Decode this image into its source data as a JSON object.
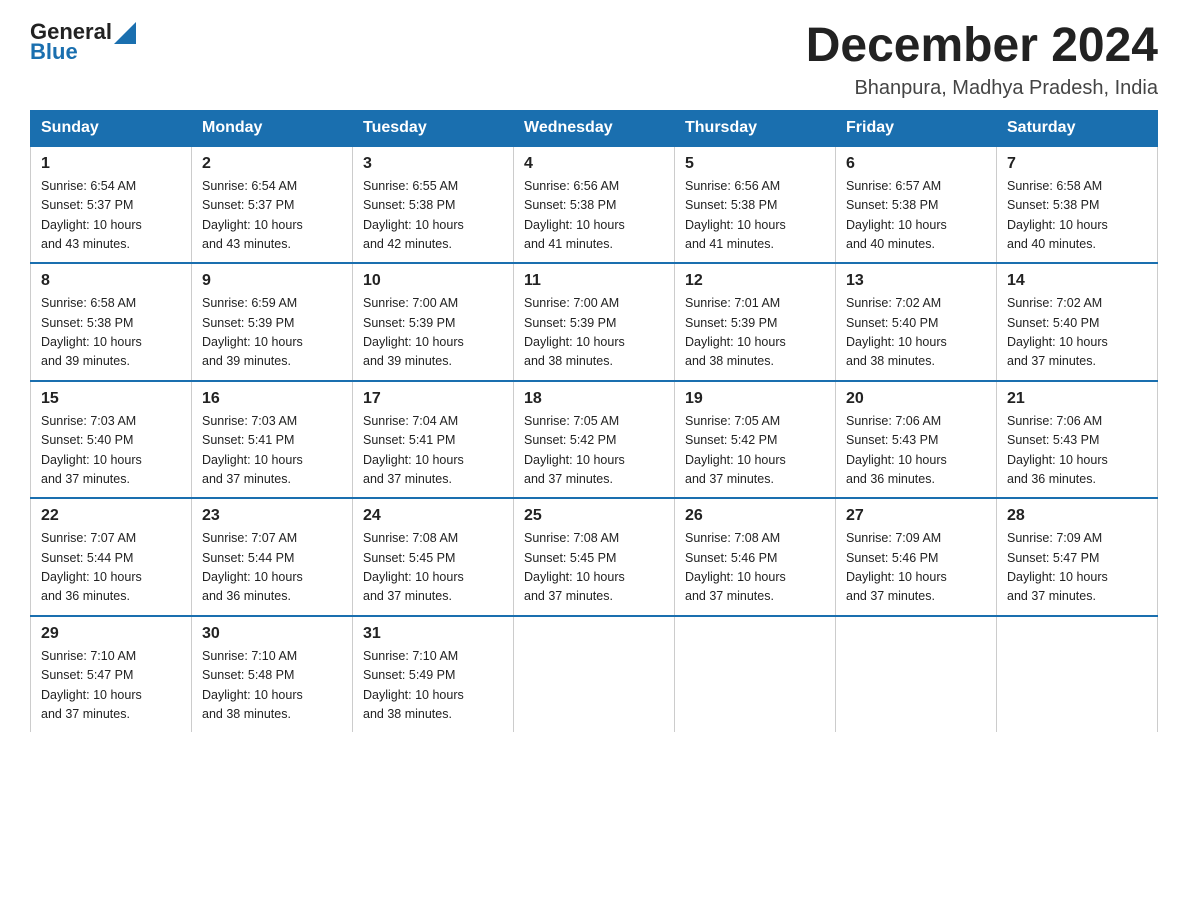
{
  "header": {
    "logo_text_main": "General",
    "logo_text_blue": "Blue",
    "month_year": "December 2024",
    "location": "Bhanpura, Madhya Pradesh, India"
  },
  "days_of_week": [
    "Sunday",
    "Monday",
    "Tuesday",
    "Wednesday",
    "Thursday",
    "Friday",
    "Saturday"
  ],
  "weeks": [
    [
      {
        "day": "1",
        "sunrise": "6:54 AM",
        "sunset": "5:37 PM",
        "daylight": "10 hours and 43 minutes."
      },
      {
        "day": "2",
        "sunrise": "6:54 AM",
        "sunset": "5:37 PM",
        "daylight": "10 hours and 43 minutes."
      },
      {
        "day": "3",
        "sunrise": "6:55 AM",
        "sunset": "5:38 PM",
        "daylight": "10 hours and 42 minutes."
      },
      {
        "day": "4",
        "sunrise": "6:56 AM",
        "sunset": "5:38 PM",
        "daylight": "10 hours and 41 minutes."
      },
      {
        "day": "5",
        "sunrise": "6:56 AM",
        "sunset": "5:38 PM",
        "daylight": "10 hours and 41 minutes."
      },
      {
        "day": "6",
        "sunrise": "6:57 AM",
        "sunset": "5:38 PM",
        "daylight": "10 hours and 40 minutes."
      },
      {
        "day": "7",
        "sunrise": "6:58 AM",
        "sunset": "5:38 PM",
        "daylight": "10 hours and 40 minutes."
      }
    ],
    [
      {
        "day": "8",
        "sunrise": "6:58 AM",
        "sunset": "5:38 PM",
        "daylight": "10 hours and 39 minutes."
      },
      {
        "day": "9",
        "sunrise": "6:59 AM",
        "sunset": "5:39 PM",
        "daylight": "10 hours and 39 minutes."
      },
      {
        "day": "10",
        "sunrise": "7:00 AM",
        "sunset": "5:39 PM",
        "daylight": "10 hours and 39 minutes."
      },
      {
        "day": "11",
        "sunrise": "7:00 AM",
        "sunset": "5:39 PM",
        "daylight": "10 hours and 38 minutes."
      },
      {
        "day": "12",
        "sunrise": "7:01 AM",
        "sunset": "5:39 PM",
        "daylight": "10 hours and 38 minutes."
      },
      {
        "day": "13",
        "sunrise": "7:02 AM",
        "sunset": "5:40 PM",
        "daylight": "10 hours and 38 minutes."
      },
      {
        "day": "14",
        "sunrise": "7:02 AM",
        "sunset": "5:40 PM",
        "daylight": "10 hours and 37 minutes."
      }
    ],
    [
      {
        "day": "15",
        "sunrise": "7:03 AM",
        "sunset": "5:40 PM",
        "daylight": "10 hours and 37 minutes."
      },
      {
        "day": "16",
        "sunrise": "7:03 AM",
        "sunset": "5:41 PM",
        "daylight": "10 hours and 37 minutes."
      },
      {
        "day": "17",
        "sunrise": "7:04 AM",
        "sunset": "5:41 PM",
        "daylight": "10 hours and 37 minutes."
      },
      {
        "day": "18",
        "sunrise": "7:05 AM",
        "sunset": "5:42 PM",
        "daylight": "10 hours and 37 minutes."
      },
      {
        "day": "19",
        "sunrise": "7:05 AM",
        "sunset": "5:42 PM",
        "daylight": "10 hours and 37 minutes."
      },
      {
        "day": "20",
        "sunrise": "7:06 AM",
        "sunset": "5:43 PM",
        "daylight": "10 hours and 36 minutes."
      },
      {
        "day": "21",
        "sunrise": "7:06 AM",
        "sunset": "5:43 PM",
        "daylight": "10 hours and 36 minutes."
      }
    ],
    [
      {
        "day": "22",
        "sunrise": "7:07 AM",
        "sunset": "5:44 PM",
        "daylight": "10 hours and 36 minutes."
      },
      {
        "day": "23",
        "sunrise": "7:07 AM",
        "sunset": "5:44 PM",
        "daylight": "10 hours and 36 minutes."
      },
      {
        "day": "24",
        "sunrise": "7:08 AM",
        "sunset": "5:45 PM",
        "daylight": "10 hours and 37 minutes."
      },
      {
        "day": "25",
        "sunrise": "7:08 AM",
        "sunset": "5:45 PM",
        "daylight": "10 hours and 37 minutes."
      },
      {
        "day": "26",
        "sunrise": "7:08 AM",
        "sunset": "5:46 PM",
        "daylight": "10 hours and 37 minutes."
      },
      {
        "day": "27",
        "sunrise": "7:09 AM",
        "sunset": "5:46 PM",
        "daylight": "10 hours and 37 minutes."
      },
      {
        "day": "28",
        "sunrise": "7:09 AM",
        "sunset": "5:47 PM",
        "daylight": "10 hours and 37 minutes."
      }
    ],
    [
      {
        "day": "29",
        "sunrise": "7:10 AM",
        "sunset": "5:47 PM",
        "daylight": "10 hours and 37 minutes."
      },
      {
        "day": "30",
        "sunrise": "7:10 AM",
        "sunset": "5:48 PM",
        "daylight": "10 hours and 38 minutes."
      },
      {
        "day": "31",
        "sunrise": "7:10 AM",
        "sunset": "5:49 PM",
        "daylight": "10 hours and 38 minutes."
      },
      null,
      null,
      null,
      null
    ]
  ]
}
